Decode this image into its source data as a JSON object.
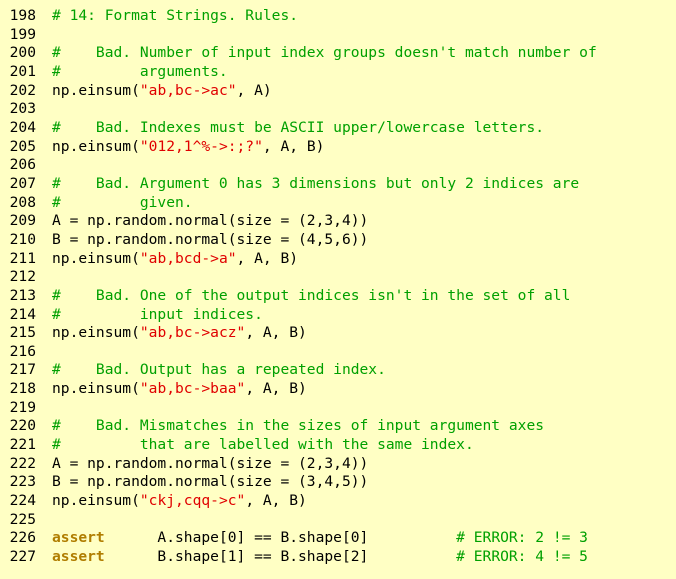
{
  "editor": {
    "lines": [
      {
        "num": "198",
        "tokens": [
          {
            "t": "comment",
            "v": "# 14: Format Strings. Rules."
          }
        ]
      },
      {
        "num": "199",
        "tokens": []
      },
      {
        "num": "200",
        "tokens": [
          {
            "t": "comment",
            "v": "#    Bad. Number of input index groups doesn't match number of"
          }
        ]
      },
      {
        "num": "201",
        "tokens": [
          {
            "t": "comment",
            "v": "#         arguments."
          }
        ]
      },
      {
        "num": "202",
        "tokens": [
          {
            "t": "plain",
            "v": "np.einsum("
          },
          {
            "t": "string",
            "v": "\"ab,bc->ac\""
          },
          {
            "t": "plain",
            "v": ", A)"
          }
        ]
      },
      {
        "num": "203",
        "tokens": []
      },
      {
        "num": "204",
        "tokens": [
          {
            "t": "comment",
            "v": "#    Bad. Indexes must be ASCII upper/lowercase letters."
          }
        ]
      },
      {
        "num": "205",
        "tokens": [
          {
            "t": "plain",
            "v": "np.einsum("
          },
          {
            "t": "string",
            "v": "\"012,1^%->:;?\""
          },
          {
            "t": "plain",
            "v": ", A, B)"
          }
        ]
      },
      {
        "num": "206",
        "tokens": []
      },
      {
        "num": "207",
        "tokens": [
          {
            "t": "comment",
            "v": "#    Bad. Argument 0 has 3 dimensions but only 2 indices are"
          }
        ]
      },
      {
        "num": "208",
        "tokens": [
          {
            "t": "comment",
            "v": "#         given."
          }
        ]
      },
      {
        "num": "209",
        "tokens": [
          {
            "t": "plain",
            "v": "A = np.random.normal(size = (2,3,4))"
          }
        ]
      },
      {
        "num": "210",
        "tokens": [
          {
            "t": "plain",
            "v": "B = np.random.normal(size = (4,5,6))"
          }
        ]
      },
      {
        "num": "211",
        "tokens": [
          {
            "t": "plain",
            "v": "np.einsum("
          },
          {
            "t": "string",
            "v": "\"ab,bcd->a\""
          },
          {
            "t": "plain",
            "v": ", A, B)"
          }
        ]
      },
      {
        "num": "212",
        "tokens": []
      },
      {
        "num": "213",
        "tokens": [
          {
            "t": "comment",
            "v": "#    Bad. One of the output indices isn't in the set of all"
          }
        ]
      },
      {
        "num": "214",
        "tokens": [
          {
            "t": "comment",
            "v": "#         input indices."
          }
        ]
      },
      {
        "num": "215",
        "tokens": [
          {
            "t": "plain",
            "v": "np.einsum("
          },
          {
            "t": "string",
            "v": "\"ab,bc->acz\""
          },
          {
            "t": "plain",
            "v": ", A, B)"
          }
        ]
      },
      {
        "num": "216",
        "tokens": []
      },
      {
        "num": "217",
        "tokens": [
          {
            "t": "comment",
            "v": "#    Bad. Output has a repeated index."
          }
        ]
      },
      {
        "num": "218",
        "tokens": [
          {
            "t": "plain",
            "v": "np.einsum("
          },
          {
            "t": "string",
            "v": "\"ab,bc->baa\""
          },
          {
            "t": "plain",
            "v": ", A, B)"
          }
        ]
      },
      {
        "num": "219",
        "tokens": []
      },
      {
        "num": "220",
        "tokens": [
          {
            "t": "comment",
            "v": "#    Bad. Mismatches in the sizes of input argument axes"
          }
        ]
      },
      {
        "num": "221",
        "tokens": [
          {
            "t": "comment",
            "v": "#         that are labelled with the same index."
          }
        ]
      },
      {
        "num": "222",
        "tokens": [
          {
            "t": "plain",
            "v": "A = np.random.normal(size = (2,3,4))"
          }
        ]
      },
      {
        "num": "223",
        "tokens": [
          {
            "t": "plain",
            "v": "B = np.random.normal(size = (3,4,5))"
          }
        ]
      },
      {
        "num": "224",
        "tokens": [
          {
            "t": "plain",
            "v": "np.einsum("
          },
          {
            "t": "string",
            "v": "\"ckj,cqq->c\""
          },
          {
            "t": "plain",
            "v": ", A, B)"
          }
        ]
      },
      {
        "num": "225",
        "tokens": []
      },
      {
        "num": "226",
        "tokens": [
          {
            "t": "keyword",
            "v": "assert"
          },
          {
            "t": "plain",
            "v": "      A.shape[0] == B.shape[0]          "
          },
          {
            "t": "comment",
            "v": "# ERROR: 2 != 3"
          }
        ]
      },
      {
        "num": "227",
        "tokens": [
          {
            "t": "keyword",
            "v": "assert"
          },
          {
            "t": "plain",
            "v": "      B.shape[1] == B.shape[2]          "
          },
          {
            "t": "comment",
            "v": "# ERROR: 4 != 5"
          }
        ]
      }
    ]
  },
  "colors": {
    "background": "#ffffc4",
    "comment": "#00a000",
    "string": "#e00000",
    "keyword": "#b07d00",
    "plain": "#000000"
  }
}
